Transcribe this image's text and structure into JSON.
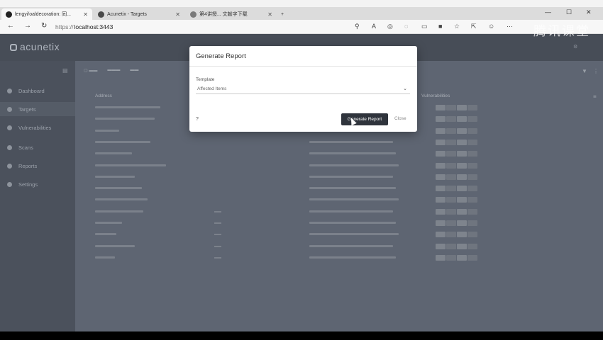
{
  "browser": {
    "tabs": [
      {
        "label": "lengyi/oaldecoration: 同... ",
        "favicon_color": "#222"
      },
      {
        "label": "Acunetix - Targets",
        "favicon_color": "#4a4a4a"
      },
      {
        "label": "第4讲授... 文献字下载",
        "favicon_color": "#7a7a7a"
      }
    ],
    "new_tab": "+",
    "url_scheme": "https://",
    "url_host": "localhost:3443",
    "window_controls": [
      "—",
      "☐",
      "✕"
    ]
  },
  "app": {
    "logo": "acunetix",
    "top_right_text": "",
    "sidebar": [
      {
        "label": "Dashboard",
        "icon": "dashboard-icon"
      },
      {
        "label": "Targets",
        "icon": "target-icon"
      },
      {
        "label": "Vulnerabilities",
        "icon": "bug-icon"
      },
      {
        "label": "Scans",
        "icon": "scan-icon"
      },
      {
        "label": "Reports",
        "icon": "report-icon"
      },
      {
        "label": "Settings",
        "icon": "gear-icon"
      }
    ],
    "table": {
      "columns": [
        "Address",
        "Vulnerabilities"
      ]
    }
  },
  "modal": {
    "title": "Generate Report",
    "template_label": "Template",
    "template_value": "Affected Items",
    "generate_button": "Generate Report",
    "close_button": "Close"
  },
  "watermark": "腾讯课堂"
}
